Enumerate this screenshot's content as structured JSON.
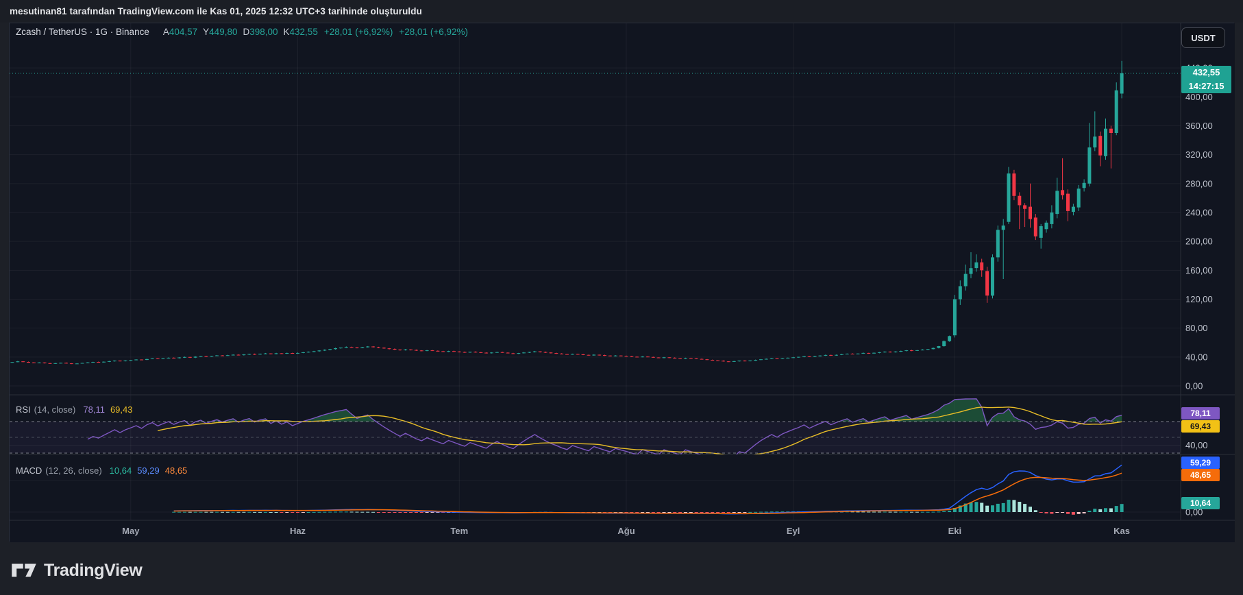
{
  "attribution": "mesutinan81 tarafından TradingView.com ile Kas 01, 2025 12:32 UTC+3 tarihinde oluşturuldu",
  "currency_button": "USDT",
  "header": {
    "title": "Zcash / TetherUS · 1G · Binance",
    "fields": [
      [
        "A",
        "404,57"
      ],
      [
        "Y",
        "449,80"
      ],
      [
        "D",
        "398,00"
      ],
      [
        "K",
        "432,55"
      ]
    ],
    "change": "+28,01 (+6,92%)",
    "change_dup": "+28,01 (+6,92%)"
  },
  "price_scale": {
    "last": "432,55",
    "countdown": "14:27:15"
  },
  "rsi_panel": {
    "title": "RSI",
    "params": "(14, close)",
    "value": "78,11",
    "ma_value": "69,43",
    "scale_label": "40,00"
  },
  "macd_panel": {
    "title": "MACD",
    "params": "(12, 26, close)",
    "hist_value": "10,64",
    "macd_value": "59,29",
    "signal_value": "48,65",
    "zero_label": "0,00"
  },
  "logo_text": "TradingView",
  "colors": {
    "up": "#26a69a",
    "down": "#f23645",
    "rsi_line": "#7e57c2",
    "rsi_ma": "#e8bd27",
    "rsi_fill": "rgba(126,87,194,0.08)",
    "rsi_over_fill": "rgba(46,160,87,0.4)",
    "macd_line": "#2962ff",
    "signal_line": "#f56c0a",
    "hist_up": "#26a69a",
    "hist_up_fade": "#ace5dc",
    "hist_dn": "#f7525f",
    "hist_dn_fade": "#fccbcd",
    "grid": "rgba(255,255,255,0.05)",
    "separator": "#2a2e39",
    "axis_text": "#bfc3cd",
    "time_text": "#a6abb6",
    "dashed": "#8a8d98"
  },
  "chart_data": {
    "type": "candlestick",
    "title": "Zcash / TetherUS · 1G · Binance",
    "interval": "1G",
    "x_axis": {
      "labels": [
        {
          "label": "May",
          "index": 22
        },
        {
          "label": "Haz",
          "index": 53
        },
        {
          "label": "Tem",
          "index": 83
        },
        {
          "label": "Ağu",
          "index": 114
        },
        {
          "label": "Eyl",
          "index": 145
        },
        {
          "label": "Eki",
          "index": 175
        },
        {
          "label": "Kas",
          "index": 206
        }
      ]
    },
    "price_axis": {
      "ticks": [
        440,
        400,
        360,
        320,
        280,
        240,
        200,
        160,
        120,
        80,
        40,
        0
      ]
    },
    "rsi_axis_ticks": [
      40
    ],
    "macd_axis_ticks": [
      0
    ],
    "series": {
      "start_close": 32.5,
      "daily_closes_apr_sep": [
        33,
        34,
        33.2,
        32.5,
        31.8,
        32.4,
        31.5,
        30.8,
        31.5,
        32,
        31.2,
        30.5,
        31,
        31.8,
        32.5,
        33.2,
        32.8,
        33.5,
        34.2,
        35,
        34.4,
        35.2,
        35.8,
        36.5,
        36,
        37.2,
        38,
        37.4,
        38.2,
        39,
        38.5,
        39.4,
        40,
        39.2,
        40.5,
        41.2,
        40.6,
        41.5,
        42.2,
        41.8,
        42.5,
        43.2,
        42.6,
        43.5,
        44.2,
        43.6,
        44.5,
        45,
        44.2,
        45.2,
        44.6,
        45.5,
        44.8,
        45.6,
        46.5,
        47.2,
        48,
        49,
        50,
        51,
        52.2,
        53,
        54,
        53.2,
        52.4,
        53.5,
        54.5,
        53.6,
        52.8,
        52,
        51.2,
        50.4,
        49.6,
        50.5,
        49.8,
        49,
        48.4,
        49.2,
        48.6,
        48,
        47.4,
        48.2,
        47.6,
        47,
        46.4,
        47.2,
        46.6,
        46,
        45.4,
        46.2,
        46.8,
        46,
        45.2,
        44.6,
        45.4,
        46.2,
        47,
        47.8,
        47,
        46.2,
        45.4,
        44.8,
        44,
        43.4,
        44.2,
        43.6,
        43,
        42.4,
        43.2,
        42.6,
        42,
        41.4,
        42,
        41.5,
        41,
        40.4,
        39.8,
        40.6,
        40,
        39.4,
        38.8,
        39.6,
        39,
        38.4,
        37.8,
        38.6,
        38,
        37.4,
        36.8,
        36,
        35.4,
        34.8,
        34,
        33.5,
        34.2,
        35,
        34.5,
        35.2,
        36,
        36.8,
        37.5,
        38.2,
        37.6,
        38.4,
        39,
        39.6,
        40.2,
        41,
        40.4,
        41.2,
        42,
        42.8,
        42.2,
        43,
        43.8,
        44.6,
        44,
        44.8,
        45.6,
        45,
        45.8,
        46.6,
        47.4,
        46.8,
        47.6,
        48.4,
        49.2,
        48.6,
        49.4,
        50.2,
        51,
        52.5,
        55,
        62,
        69
      ],
      "ohlc_oct_nov": [
        [
          70,
          126,
          67,
          120
        ],
        [
          120,
          146,
          112,
          138
        ],
        [
          138,
          168,
          132,
          155
        ],
        [
          155,
          185,
          149,
          163
        ],
        [
          163,
          182,
          158,
          171
        ],
        [
          171,
          176,
          151,
          160
        ],
        [
          159,
          165,
          115,
          125
        ],
        [
          125,
          182,
          121,
          178
        ],
        [
          178,
          222,
          172,
          216
        ],
        [
          216,
          231,
          148,
          222
        ],
        [
          227,
          303,
          224,
          294
        ],
        [
          294,
          299,
          257,
          263
        ],
        [
          263,
          268,
          217,
          250
        ],
        [
          250,
          253,
          220,
          245
        ],
        [
          248,
          280,
          219,
          231
        ],
        [
          233,
          238,
          202,
          207
        ],
        [
          205,
          224,
          190,
          221
        ],
        [
          217,
          229,
          212,
          226
        ],
        [
          224,
          250,
          218,
          240
        ],
        [
          238,
          288,
          232,
          270
        ],
        [
          271,
          315,
          258,
          264
        ],
        [
          266,
          272,
          228,
          242
        ],
        [
          241,
          252,
          236,
          248
        ],
        [
          247,
          278,
          242,
          273
        ],
        [
          274,
          286,
          269,
          281
        ],
        [
          280,
          364,
          276,
          330
        ],
        [
          330,
          380,
          325,
          345
        ],
        [
          346,
          352,
          304,
          319
        ],
        [
          318,
          370,
          313,
          356
        ],
        [
          356,
          360,
          301,
          350
        ],
        [
          350,
          420,
          347,
          409
        ],
        [
          404.57,
          449.8,
          398,
          432.55
        ]
      ]
    },
    "indicators": {
      "rsi": {
        "length": 14,
        "ma_length": 14,
        "levels": [
          70,
          50,
          30
        ],
        "last": 78.11,
        "ma_last": 69.43
      },
      "macd": {
        "fast": 12,
        "slow": 26,
        "signal": 9,
        "last": 59.29,
        "signal_last": 48.65,
        "hist_last": 10.64
      }
    },
    "last": {
      "open": 404.57,
      "high": 449.8,
      "low": 398,
      "price": 432.55,
      "change": "+28,01 (+6,92%)"
    }
  }
}
